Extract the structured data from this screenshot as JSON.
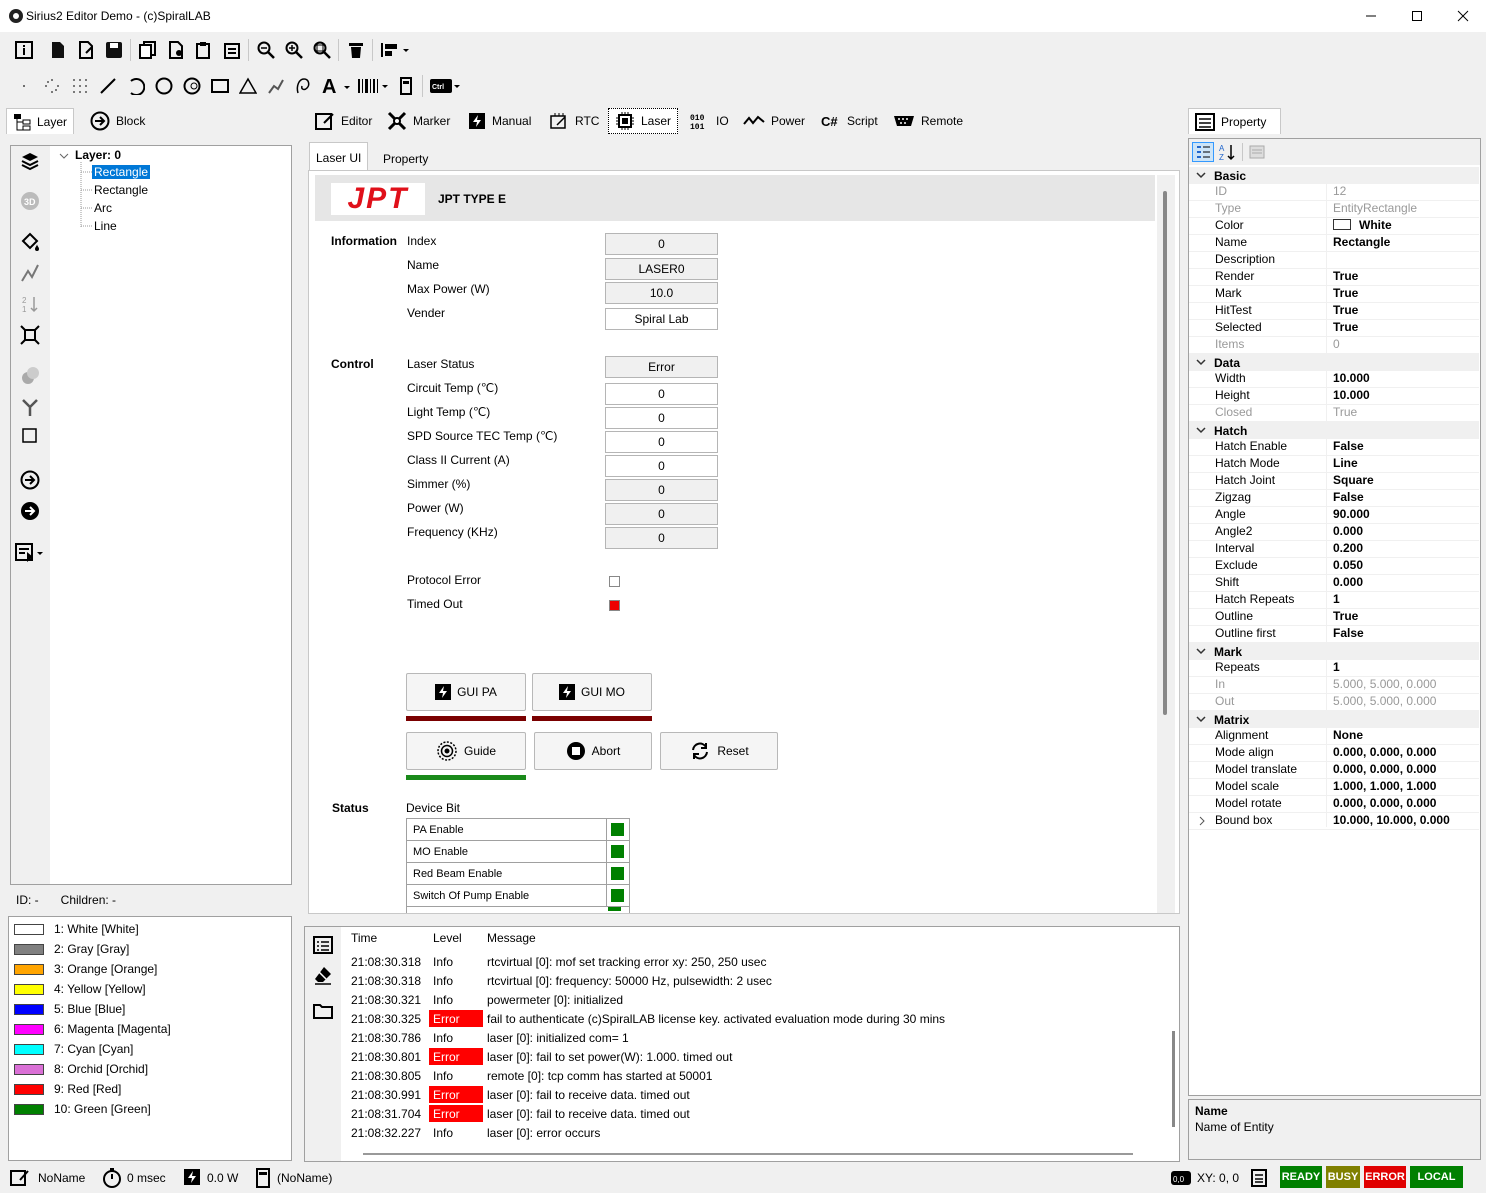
{
  "window": {
    "title": "Sirius2 Editor Demo - (c)SpiralLAB"
  },
  "left_tabs": [
    {
      "label": "Layer"
    },
    {
      "label": "Block"
    }
  ],
  "tree": {
    "root": "Layer: 0",
    "items": [
      "Rectangle",
      "Rectangle",
      "Arc",
      "Line"
    ]
  },
  "tree_status": {
    "id": "ID: -",
    "children": "Children: -"
  },
  "pens": [
    {
      "label": "1: White [White]",
      "color": "#ffffff"
    },
    {
      "label": "2: Gray [Gray]",
      "color": "#808080"
    },
    {
      "label": "3: Orange [Orange]",
      "color": "#ffa500"
    },
    {
      "label": "4: Yellow [Yellow]",
      "color": "#ffff00"
    },
    {
      "label": "5: Blue [Blue]",
      "color": "#0000ff"
    },
    {
      "label": "6: Magenta [Magenta]",
      "color": "#ff00ff"
    },
    {
      "label": "7: Cyan [Cyan]",
      "color": "#00ffff"
    },
    {
      "label": "8: Orchid [Orchid]",
      "color": "#da70d6"
    },
    {
      "label": "9: Red [Red]",
      "color": "#ff0000"
    },
    {
      "label": "10: Green [Green]",
      "color": "#008000"
    }
  ],
  "center_tabs": [
    {
      "label": "Editor"
    },
    {
      "label": "Marker"
    },
    {
      "label": "Manual"
    },
    {
      "label": "RTC"
    },
    {
      "label": "Laser"
    },
    {
      "label": "IO"
    },
    {
      "label": "Power"
    },
    {
      "label": "Script"
    },
    {
      "label": "Remote"
    }
  ],
  "laser_subtabs": [
    {
      "label": "Laser UI"
    },
    {
      "label": "Property"
    }
  ],
  "laser": {
    "logo": "JPT",
    "model": "JPT TYPE E",
    "information_label": "Information",
    "index_label": "Index",
    "index": "0",
    "name_label": "Name",
    "name": "LASER0",
    "maxpower_label": "Max Power (W)",
    "maxpower": "10.0",
    "vender_label": "Vender",
    "vender": "Spiral Lab",
    "control_label": "Control",
    "status_label": "Laser Status",
    "status": "Error",
    "circuit_label": "Circuit Temp (℃)",
    "circuit": "0",
    "light_label": "Light Temp (℃)",
    "light": "0",
    "spd_label": "SPD Source TEC Temp (℃)",
    "spd": "0",
    "class2_label": "Class II Current (A)",
    "class2": "0",
    "simmer_label": "Simmer (%)",
    "simmer": "0",
    "power_label": "Power (W)",
    "power": "0",
    "freq_label": "Frequency (KHz)",
    "freq": "0",
    "protocol_label": "Protocol Error",
    "timedout_label": "Timed Out",
    "gui_pa": "GUI PA",
    "gui_mo": "GUI MO",
    "guide": "Guide",
    "abort": "Abort",
    "reset": "Reset",
    "status_section": "Status",
    "device_bit": "Device Bit",
    "device_bits": [
      "PA Enable",
      "MO Enable",
      "Red Beam Enable",
      "Switch Of Pump Enable"
    ]
  },
  "property_panel": {
    "tab": "Property",
    "categories": [
      {
        "name": "Basic",
        "rows": [
          {
            "name": "ID",
            "value": "12",
            "dim": true
          },
          {
            "name": "Type",
            "value": "EntityRectangle",
            "dim": true
          },
          {
            "name": "Color",
            "value": "White",
            "swatch": "#ffffff"
          },
          {
            "name": "Name",
            "value": "Rectangle"
          },
          {
            "name": "Description",
            "value": ""
          },
          {
            "name": "Render",
            "value": "True"
          },
          {
            "name": "Mark",
            "value": "True"
          },
          {
            "name": "HitTest",
            "value": "True"
          },
          {
            "name": "Selected",
            "value": "True"
          },
          {
            "name": "Items",
            "value": "0",
            "dim": true
          }
        ]
      },
      {
        "name": "Data",
        "rows": [
          {
            "name": "Width",
            "value": "10.000"
          },
          {
            "name": "Height",
            "value": "10.000"
          },
          {
            "name": "Closed",
            "value": "True",
            "dim": true
          }
        ]
      },
      {
        "name": "Hatch",
        "rows": [
          {
            "name": "Hatch Enable",
            "value": "False"
          },
          {
            "name": "Hatch Mode",
            "value": "Line"
          },
          {
            "name": "Hatch Joint",
            "value": "Square"
          },
          {
            "name": "Zigzag",
            "value": "False"
          },
          {
            "name": "Angle",
            "value": "90.000"
          },
          {
            "name": "Angle2",
            "value": "0.000"
          },
          {
            "name": "Interval",
            "value": "0.200"
          },
          {
            "name": "Exclude",
            "value": "0.050"
          },
          {
            "name": "Shift",
            "value": "0.000"
          },
          {
            "name": "Hatch Repeats",
            "value": "1"
          },
          {
            "name": "Outline",
            "value": "True"
          },
          {
            "name": "Outline first",
            "value": "False"
          }
        ]
      },
      {
        "name": "Mark",
        "rows": [
          {
            "name": "Repeats",
            "value": "1"
          },
          {
            "name": "In",
            "value": "5.000, 5.000, 0.000",
            "dim": true
          },
          {
            "name": "Out",
            "value": "5.000, 5.000, 0.000",
            "dim": true
          }
        ]
      },
      {
        "name": "Matrix",
        "rows": [
          {
            "name": "Alignment",
            "value": "None"
          },
          {
            "name": "Mode align",
            "value": "0.000, 0.000, 0.000"
          },
          {
            "name": "Model translate",
            "value": "0.000, 0.000, 0.000"
          },
          {
            "name": "Model scale",
            "value": "1.000, 1.000, 1.000"
          },
          {
            "name": "Model rotate",
            "value": "0.000, 0.000, 0.000"
          },
          {
            "name": "Bound box",
            "value": "10.000, 10.000, 0.000",
            "expandable": true
          }
        ]
      }
    ],
    "help_title": "Name",
    "help_text": "Name of Entity"
  },
  "log": {
    "headers": {
      "time": "Time",
      "level": "Level",
      "message": "Message"
    },
    "rows": [
      {
        "time": "21:08:30.318",
        "level": "Info",
        "message": "rtcvirtual [0]: mof set tracking error xy: 250, 250 usec"
      },
      {
        "time": "21:08:30.318",
        "level": "Info",
        "message": "rtcvirtual [0]: frequency: 50000 Hz, pulsewidth: 2 usec"
      },
      {
        "time": "21:08:30.321",
        "level": "Info",
        "message": "powermeter [0]: initialized"
      },
      {
        "time": "21:08:30.325",
        "level": "Error",
        "message": "fail to authenticate (c)SpiralLAB license key. activated evaluation mode during 30 mins"
      },
      {
        "time": "21:08:30.786",
        "level": "Info",
        "message": "laser [0]: initialized com= 1"
      },
      {
        "time": "21:08:30.801",
        "level": "Error",
        "message": "laser [0]: fail to set power(W): 1.000. timed out"
      },
      {
        "time": "21:08:30.805",
        "level": "Info",
        "message": "remote [0]: tcp comm has started at 50001"
      },
      {
        "time": "21:08:30.991",
        "level": "Error",
        "message": "laser [0]: fail to receive data. timed out"
      },
      {
        "time": "21:08:31.704",
        "level": "Error",
        "message": "laser [0]: fail to receive data. timed out"
      },
      {
        "time": "21:08:32.227",
        "level": "Info",
        "message": "laser [0]: error occurs"
      }
    ]
  },
  "statusbar": {
    "name": "NoName",
    "time": "0 msec",
    "power": "0.0 W",
    "doc": "(NoName)",
    "xy": "XY: 0, 0",
    "ready": "READY",
    "busy": "BUSY",
    "error": "ERROR",
    "local": "LOCAL"
  },
  "colors": {
    "ready": "#008000",
    "busy": "#808000",
    "error": "#e00000",
    "local": "#008000",
    "selection": "#0078d7"
  }
}
